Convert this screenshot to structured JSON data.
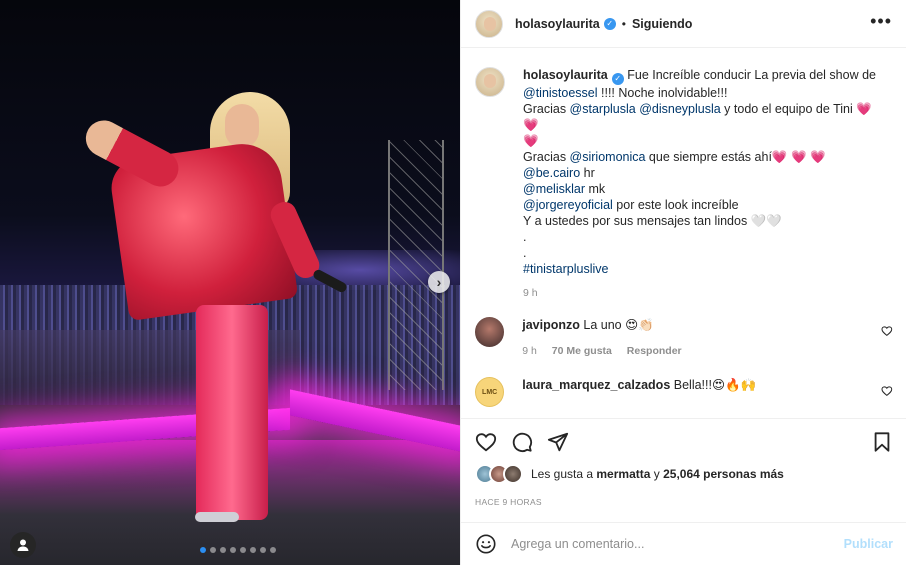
{
  "post": {
    "username": "holasoylaurita",
    "verified_mark": "✓",
    "separator": "•",
    "follow_state": "Siguiendo",
    "more_label": "•••"
  },
  "caption": {
    "username": "holasoylaurita",
    "lines": [
      [
        "Fue Increíble conducir La previa del show de "
      ],
      [
        "@tinistoessel",
        " !!!! Noche inolvidable!!!"
      ],
      [
        "Gracias ",
        "@starplusla",
        " ",
        "@disneyplusla",
        " y todo el equipo de Tini ",
        "💗 💗"
      ],
      [
        "💗"
      ],
      [
        "Gracias ",
        "@siriomonica",
        " que siempre estás ahí",
        "💗 💗 💗"
      ],
      [
        "@be.cairo",
        " hr"
      ],
      [
        "@melisklar",
        " mk"
      ],
      [
        "@jorgereyoficial",
        " por este look increíble"
      ],
      [
        "Y a ustedes por sus mensajes tan lindos 🤍🤍"
      ],
      [
        "."
      ],
      [
        "."
      ],
      [
        "#tinistarpluslive"
      ]
    ],
    "time": "9 h"
  },
  "comments": [
    {
      "username": "javiponzo",
      "text": "La uno 😍👏🏻",
      "time": "9 h",
      "likes": "70 Me gusta",
      "reply": "Responder"
    },
    {
      "username": "laura_marquez_calzados",
      "text": "Bella!!!😍🔥🙌",
      "avatar_text": "LMC"
    }
  ],
  "likes": {
    "prefix": "Les gusta a ",
    "user": "mermatta",
    "middle": " y ",
    "count": "25,064 personas más"
  },
  "ago": "HACE 9 HORAS",
  "add_comment": {
    "placeholder": "Agrega un comentario...",
    "post_label": "Publicar"
  },
  "carousel": {
    "next": "›",
    "dot_count": 8,
    "active_dot": 1
  }
}
